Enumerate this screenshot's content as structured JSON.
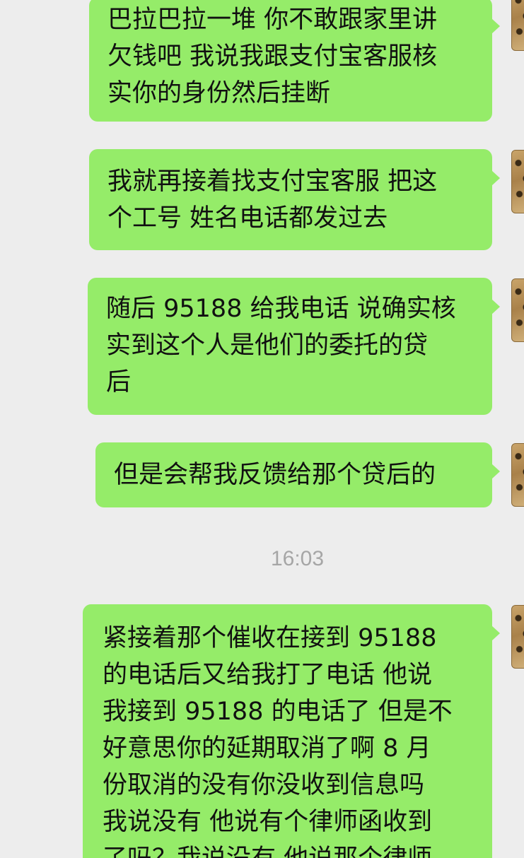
{
  "chat": {
    "timestamp": "16:03",
    "messages": [
      {
        "lines": [
          "巴拉巴拉一堆 你不敢跟家里讲",
          "欠钱吧 我说我跟支付宝客服核",
          "实你的身份然后挂断"
        ]
      },
      {
        "lines": [
          "我就再接着找支付宝客服 把这",
          "个工号 姓名电话都发过去"
        ]
      },
      {
        "lines": [
          "随后 95188 给我电话 说确实核",
          "实到这个人是他们的委托的贷",
          "后"
        ]
      },
      {
        "lines": [
          "但是会帮我反馈给那个贷后的"
        ]
      },
      {
        "lines": [
          "紧接着那个催收在接到 95188",
          "的电话后又给我打了电话 他说",
          "我接到 95188 的电话了 但是不",
          "好意思你的延期取消了啊 8 月",
          "份取消的没有你没收到信息吗",
          "我说没有 他说有个律师函收到",
          "了吗？我说没有 他说那个律师"
        ]
      }
    ]
  }
}
